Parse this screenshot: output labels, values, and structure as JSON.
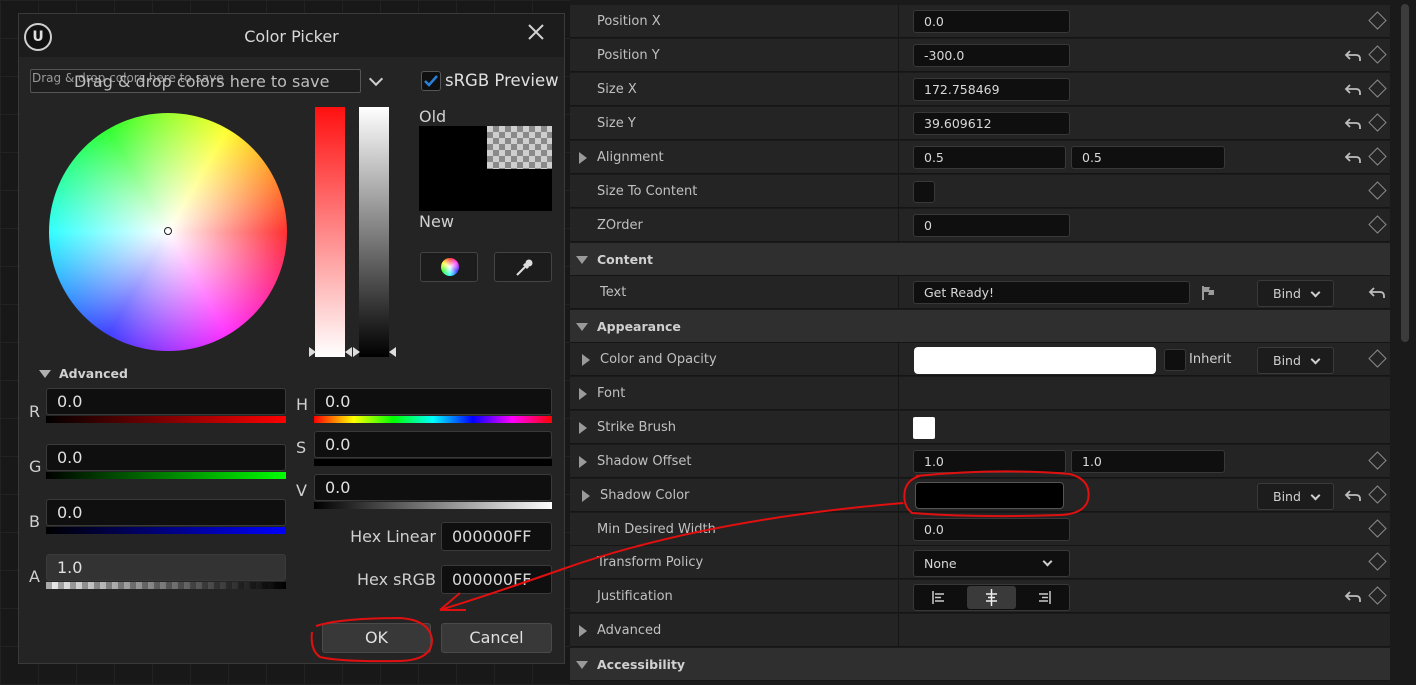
{
  "color_picker": {
    "title": "Color Picker",
    "logo_text": "U",
    "themes_hint_small": "Drag & drop colors here to save",
    "themes_hint_large": "Drag & drop colors here to save",
    "srgb_preview_label": "sRGB Preview",
    "srgb_preview_checked": true,
    "old_label": "Old",
    "new_label": "New",
    "old_color": "#000000",
    "new_color": "#000000",
    "advanced_label": "Advanced",
    "channels": {
      "r": {
        "label": "R",
        "value": "0.0"
      },
      "g": {
        "label": "G",
        "value": "0.0"
      },
      "b": {
        "label": "B",
        "value": "0.0"
      },
      "a": {
        "label": "A",
        "value": "1.0"
      },
      "h": {
        "label": "H",
        "value": "0.0"
      },
      "s": {
        "label": "S",
        "value": "0.0"
      },
      "v": {
        "label": "V",
        "value": "0.0"
      }
    },
    "hex_linear_label": "Hex Linear",
    "hex_linear_value": "000000FF",
    "hex_srgb_label": "Hex sRGB",
    "hex_srgb_value": "000000FF",
    "ok_label": "OK",
    "cancel_label": "Cancel"
  },
  "details": {
    "rows": {
      "position_x": {
        "label": "Position X",
        "value": "0.0"
      },
      "position_y": {
        "label": "Position Y",
        "value": "-300.0"
      },
      "size_x": {
        "label": "Size X",
        "value": "172.758469"
      },
      "size_y": {
        "label": "Size Y",
        "value": "39.609612"
      },
      "alignment": {
        "label": "Alignment",
        "value_x": "0.5",
        "value_y": "0.5"
      },
      "size_to_content": {
        "label": "Size To Content"
      },
      "zorder": {
        "label": "ZOrder",
        "value": "0"
      },
      "content_section": {
        "label": "Content"
      },
      "text": {
        "label": "Text",
        "value": "Get Ready!"
      },
      "appearance_section": {
        "label": "Appearance"
      },
      "color_opacity": {
        "label": "Color and Opacity",
        "inherit_label": "Inherit"
      },
      "font": {
        "label": "Font"
      },
      "strike_brush": {
        "label": "Strike Brush"
      },
      "shadow_offset": {
        "label": "Shadow Offset",
        "value_x": "1.0",
        "value_y": "1.0"
      },
      "shadow_color": {
        "label": "Shadow Color",
        "color": "#000000"
      },
      "min_desired_width": {
        "label": "Min Desired Width",
        "value": "0.0"
      },
      "transform_policy": {
        "label": "Transform Policy",
        "value": "None"
      },
      "justification": {
        "label": "Justification"
      },
      "advanced": {
        "label": "Advanced"
      },
      "accessibility_section": {
        "label": "Accessibility"
      }
    },
    "bind_label": "Bind"
  },
  "colors": {
    "accent_blue": "#2b7fd9",
    "annotation_red": "#e01010"
  }
}
